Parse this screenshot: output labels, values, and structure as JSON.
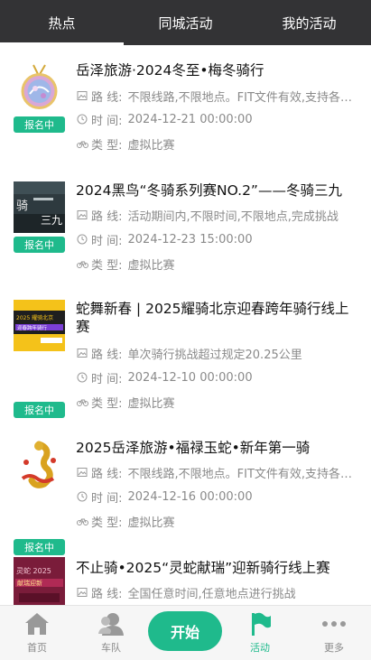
{
  "tabs": [
    "热点",
    "同城活动",
    "我的活动"
  ],
  "labels": {
    "route": "路 线:",
    "time": "时 间:",
    "type": "类 型:"
  },
  "items": [
    {
      "title": "岳泽旅游·2024冬至•梅冬骑行",
      "badge": "报名中",
      "route": "不限线路,不限地点。FIT文件有效,支持各类骑行设备",
      "time": "2024-12-21 00:00:00",
      "type": "虚拟比赛",
      "thumb_alt": "冬至骑行奖牌"
    },
    {
      "title": "2024黑鸟“冬骑系列赛NO.2”——冬骑三九",
      "badge": "报名中",
      "route": "活动期间内,不限时间,不限地点,完成挑战",
      "time": "2024-12-23 15:00:00",
      "type": "虚拟比赛",
      "thumb_alt": "冬骑三九海报"
    },
    {
      "title": "蛇舞新春 | 2025耀骑北京迎春跨年骑行线上赛",
      "badge": "报名中",
      "route": "单次骑行挑战超过规定20.25公里",
      "time": "2024-12-10 00:00:00",
      "type": "虚拟比赛",
      "thumb_alt": "2025耀骑北京海报"
    },
    {
      "title": "2025岳泽旅游•福禄玉蛇•新年第一骑",
      "badge": "报名中",
      "route": "不限线路,不限地点。FIT文件有效,支持各类骑行设备",
      "time": "2024-12-16 00:00:00",
      "type": "虚拟比赛",
      "thumb_alt": "福禄玉蛇奖牌"
    },
    {
      "title": "不止骑•2025“灵蛇献瑞”迎新骑行线上赛",
      "badge": "报名中",
      "route": "全国任意时间,任意地点进行挑战",
      "time": "",
      "type": "",
      "thumb_alt": "灵蛇献瑞海报"
    }
  ],
  "bottom_nav": {
    "home": "首页",
    "team": "车队",
    "start": "开始",
    "activity": "活动",
    "more": "更多"
  },
  "colors": {
    "accent": "#1fba8c",
    "topbar": "#333335"
  }
}
